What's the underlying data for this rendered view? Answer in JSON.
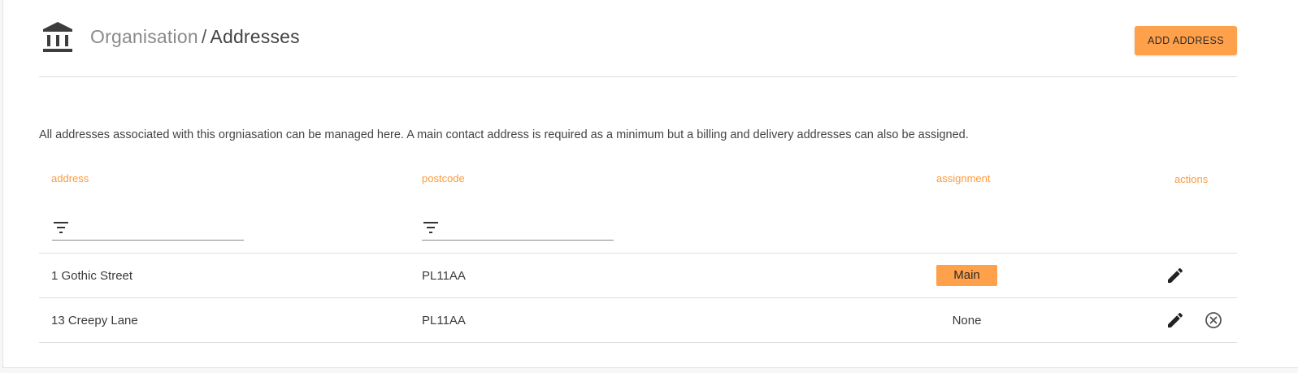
{
  "header": {
    "icon": "bank-icon",
    "breadcrumb_parent": "Organisation",
    "breadcrumb_separator": "/",
    "breadcrumb_current": "Addresses",
    "add_button_label": "ADD ADDRESS"
  },
  "description": "All addresses associated with this orgniasation can be managed here. A main contact address is required as a minimum but a billing and delivery addresses can also be assigned.",
  "table": {
    "columns": {
      "address": "address",
      "postcode": "postcode",
      "assignment": "assignment",
      "actions": "actions"
    },
    "filters": {
      "address": {
        "icon": "filter-icon",
        "value": ""
      },
      "postcode": {
        "icon": "filter-icon",
        "value": ""
      }
    },
    "rows": [
      {
        "address": "1 Gothic Street",
        "postcode": "PL11AA",
        "assignment": "Main",
        "actions": [
          "edit-icon"
        ]
      },
      {
        "address": "13 Creepy Lane",
        "postcode": "PL11AA",
        "assignment": "None",
        "actions": [
          "edit-icon",
          "remove-circle-icon"
        ]
      }
    ]
  },
  "colors": {
    "accent": "#ffa04a",
    "column_header": "#ff9a3c",
    "text": "#3a3a3a"
  }
}
